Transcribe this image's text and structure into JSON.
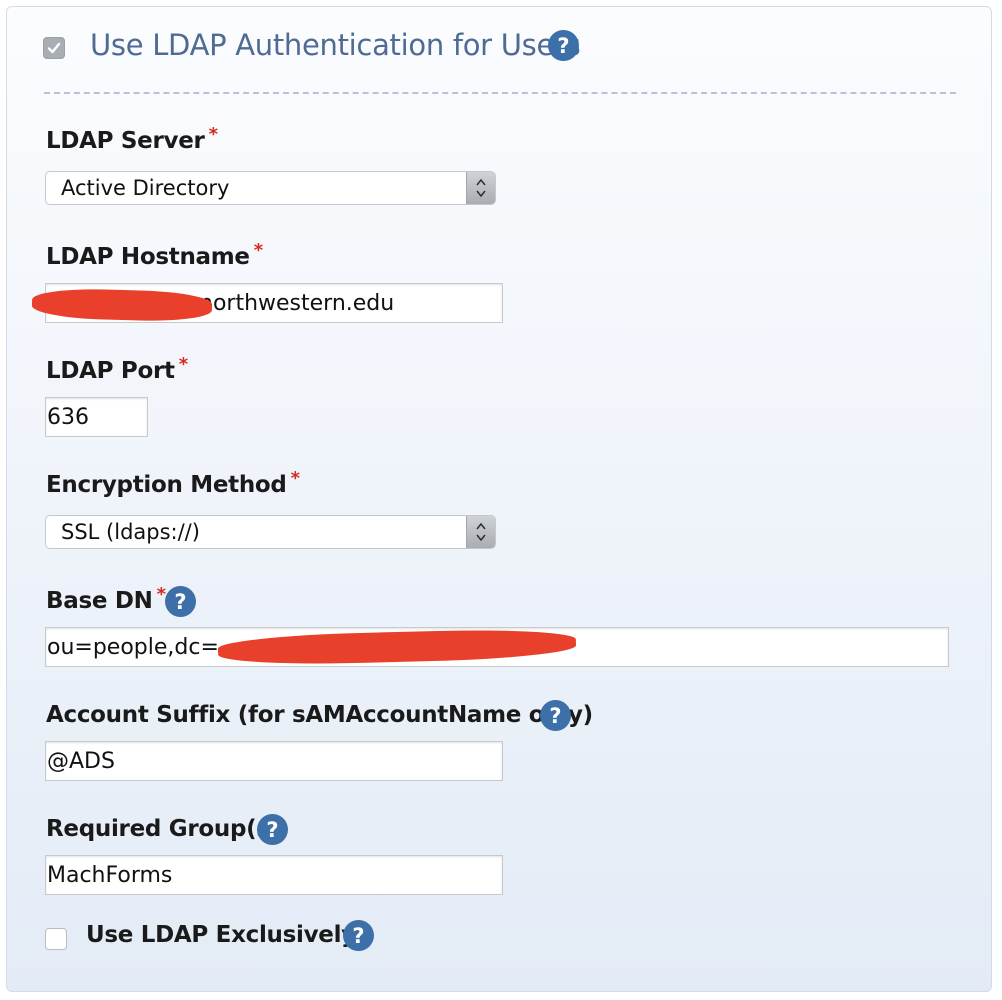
{
  "header": {
    "checkbox_checked": true,
    "title": "Use LDAP Authentication for Users",
    "help_glyph": "?"
  },
  "fields": {
    "ldap_server": {
      "label": "LDAP Server",
      "required_mark": "*",
      "value": "Active Directory"
    },
    "ldap_hostname": {
      "label": "LDAP Hostname",
      "required_mark": "*",
      "value_visible": "northwestern.edu"
    },
    "ldap_port": {
      "label": "LDAP Port",
      "required_mark": "*",
      "value": "636"
    },
    "encryption_method": {
      "label": "Encryption Method",
      "required_mark": "*",
      "value": "SSL (ldaps://)"
    },
    "base_dn": {
      "label": "Base DN",
      "required_mark": "*",
      "value_visible": "ou=people,dc="
    },
    "account_suffix": {
      "label": "Account Suffix (for sAMAccountName only)",
      "value": "@ADS"
    },
    "required_groups": {
      "label": "Required Group(s)",
      "value": "MachForms"
    },
    "use_exclusively": {
      "label": "Use LDAP Exclusively",
      "checked": false
    }
  },
  "colors": {
    "title": "#4f6b93",
    "help_icon": "#3d6fa8",
    "required": "#d52b1e",
    "redaction": "#e8402a"
  }
}
